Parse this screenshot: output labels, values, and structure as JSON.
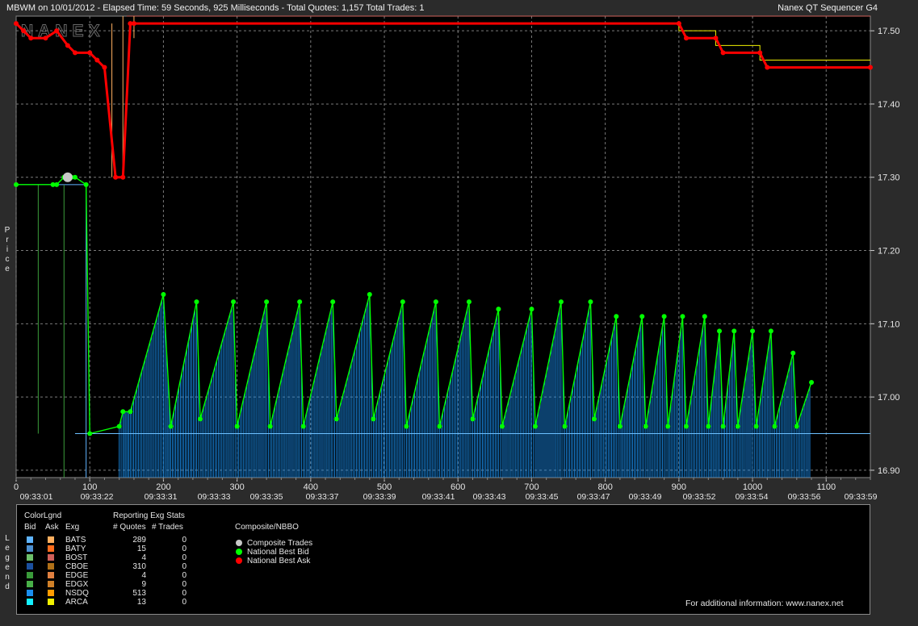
{
  "header": {
    "title": "MBWM on 10/01/2012 - Elapsed Time: 59 Seconds, 925 Milliseconds - Total Quotes: 1,157 Total Trades: 1",
    "app_name": "Nanex QT Sequencer G4",
    "watermark": "NANEX"
  },
  "axis": {
    "y_title": "Price",
    "legend_title": "Legend",
    "y_ticks": [
      "17.50",
      "17.40",
      "17.30",
      "17.20",
      "17.10",
      "17.00",
      "16.90"
    ],
    "x_ticks": [
      "0",
      "100",
      "200",
      "300",
      "400",
      "500",
      "600",
      "700",
      "800",
      "900",
      "1000",
      "1100"
    ],
    "time_ticks": [
      "09:33:01",
      "09:33:22",
      "09:33:31",
      "09:33:33",
      "09:33:35",
      "09:33:37",
      "09:33:39",
      "09:33:41",
      "09:33:43",
      "09:33:45",
      "09:33:47",
      "09:33:49",
      "09:33:52",
      "09:33:54",
      "09:33:56",
      "09:33:59"
    ]
  },
  "chart_data": {
    "type": "line",
    "title": "MBWM on 10/01/2012",
    "xlabel": "",
    "ylabel": "Price",
    "xlim": [
      0,
      1160
    ],
    "ylim": [
      16.89,
      17.52
    ],
    "grid": true,
    "series": [
      {
        "name": "National Best Ask",
        "color": "#ff0000",
        "x": [
          0,
          10,
          20,
          40,
          55,
          70,
          80,
          100,
          110,
          120,
          135,
          145,
          155,
          160,
          900,
          910,
          950,
          960,
          1010,
          1020,
          1160
        ],
        "y": [
          17.51,
          17.5,
          17.49,
          17.49,
          17.5,
          17.48,
          17.47,
          17.47,
          17.46,
          17.45,
          17.3,
          17.3,
          17.51,
          17.51,
          17.51,
          17.49,
          17.49,
          17.47,
          17.47,
          17.45,
          17.45
        ]
      },
      {
        "name": "National Best Bid",
        "color": "#00ff00",
        "x": [
          0,
          50,
          55,
          65,
          75,
          80,
          95,
          100,
          140,
          145,
          155,
          200,
          210,
          245,
          250,
          295,
          300,
          340,
          345,
          385,
          390,
          430,
          435,
          480,
          485,
          525,
          530,
          570,
          575,
          615,
          620,
          655,
          660,
          700,
          705,
          740,
          745,
          780,
          785,
          815,
          820,
          850,
          855,
          880,
          885,
          905,
          910,
          935,
          940,
          955,
          960,
          975,
          980,
          1000,
          1005,
          1025,
          1030,
          1055,
          1060,
          1080
        ],
        "y": [
          17.29,
          17.29,
          17.29,
          17.3,
          17.3,
          17.3,
          17.29,
          16.95,
          16.96,
          16.98,
          16.98,
          17.14,
          16.96,
          17.13,
          16.97,
          17.13,
          16.96,
          17.13,
          16.96,
          17.13,
          16.96,
          17.13,
          16.97,
          17.14,
          16.97,
          17.13,
          16.96,
          17.13,
          16.96,
          17.13,
          16.97,
          17.12,
          16.96,
          17.12,
          16.96,
          17.13,
          16.96,
          17.13,
          16.97,
          17.11,
          16.96,
          17.11,
          16.96,
          17.11,
          16.96,
          17.11,
          16.96,
          17.11,
          16.96,
          17.09,
          16.96,
          17.09,
          16.96,
          17.09,
          16.96,
          17.09,
          16.96,
          17.06,
          16.96,
          17.02
        ]
      },
      {
        "name": "Composite Trades",
        "color": "#c8c8c8",
        "x": [
          70
        ],
        "y": [
          17.3
        ]
      }
    ]
  },
  "legend": {
    "color_legend": "ColorLgnd",
    "reporting_stats": "Reporting Exg Stats",
    "composite": "Composite/NBBO",
    "col_bid": "Bid",
    "col_ask": "Ask",
    "col_exg": "Exg",
    "col_quotes": "# Quotes",
    "col_trades": "# Trades",
    "rows": [
      {
        "exg": "BATS",
        "quotes": "289",
        "trades": "0",
        "bid": "#5fb4ff",
        "ask": "#ffb060"
      },
      {
        "exg": "BATY",
        "quotes": "15",
        "trades": "0",
        "bid": "#4c8fd0",
        "ask": "#ff6d1c"
      },
      {
        "exg": "BOST",
        "quotes": "4",
        "trades": "0",
        "bid": "#6dc06a",
        "ask": "#d0605a"
      },
      {
        "exg": "CBOE",
        "quotes": "310",
        "trades": "0",
        "bid": "#1b50a0",
        "ask": "#b07018"
      },
      {
        "exg": "EDGE",
        "quotes": "4",
        "trades": "0",
        "bid": "#3a9b3a",
        "ask": "#e08040"
      },
      {
        "exg": "EDGX",
        "quotes": "9",
        "trades": "0",
        "bid": "#48b048",
        "ask": "#d08028"
      },
      {
        "exg": "NSDQ",
        "quotes": "513",
        "trades": "0",
        "bid": "#1a8ff0",
        "ask": "#ff9c00"
      },
      {
        "exg": "ARCA",
        "quotes": "13",
        "trades": "0",
        "bid": "#14f0ff",
        "ask": "#f0f000"
      }
    ],
    "composite_items": [
      {
        "label": "Composite Trades",
        "color": "#c8c8c8"
      },
      {
        "label": "National Best Bid",
        "color": "#00ff00"
      },
      {
        "label": "National Best Ask",
        "color": "#ff0000"
      }
    ],
    "footer": "For additional information: www.nanex.net"
  }
}
